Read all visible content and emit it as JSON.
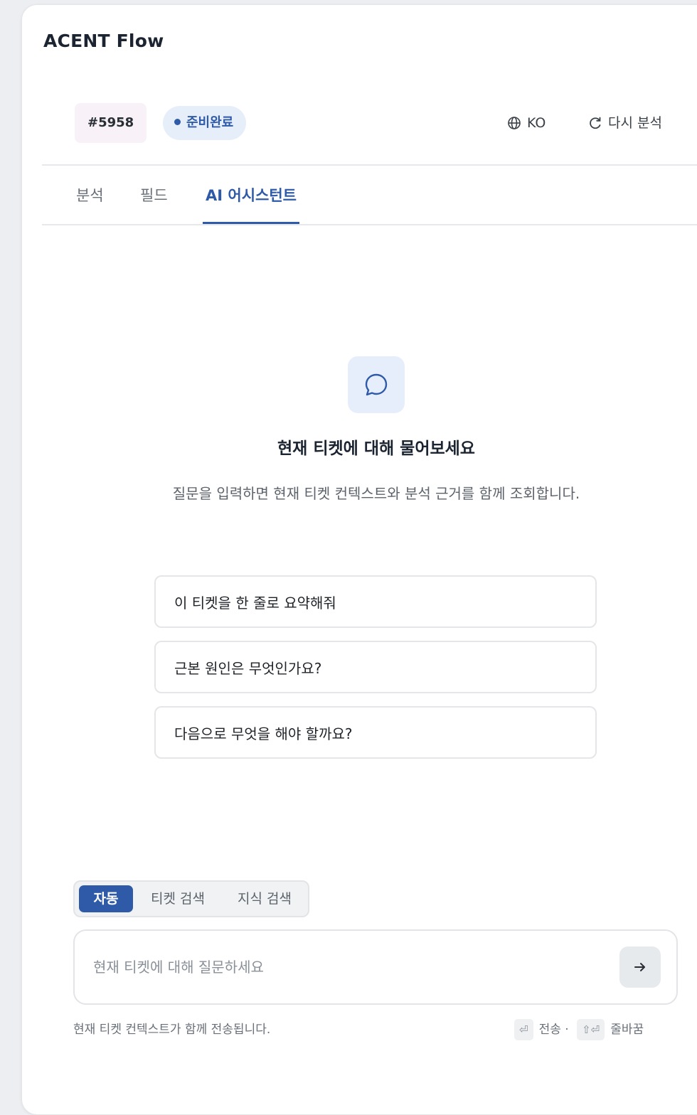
{
  "app": {
    "title": "ACENT Flow"
  },
  "ticket": {
    "id": "#5958",
    "status": "준비완료"
  },
  "header_actions": {
    "language": "KO",
    "reanalyze": "다시 분석"
  },
  "tabs": [
    {
      "label": "분석",
      "active": false
    },
    {
      "label": "필드",
      "active": false
    },
    {
      "label": "AI 어시스턴트",
      "active": true
    }
  ],
  "empty_state": {
    "icon": "chat-bubble-icon",
    "title": "현재 티켓에 대해 물어보세요",
    "description": "질문을 입력하면 현재 티켓 컨텍스트와 분석 근거를 함께 조회합니다."
  },
  "suggestions": [
    "이 티켓을 한 줄로 요약해줘",
    "근본 원인은 무엇인가요?",
    "다음으로 무엇을 해야 할까요?"
  ],
  "modes": [
    {
      "label": "자동",
      "active": true
    },
    {
      "label": "티켓 검색",
      "active": false
    },
    {
      "label": "지식 검색",
      "active": false
    }
  ],
  "composer": {
    "placeholder": "현재 티켓에 대해 질문하세요",
    "value": ""
  },
  "footer": {
    "note": "현재 티켓 컨텍스트가 함께 전송됩니다.",
    "send_key": "⏎",
    "send_label": "전송 ·",
    "newline_key": "⇧⏎",
    "newline_label": "줄바꿈"
  },
  "colors": {
    "accent": "#2f5aa8",
    "accent_soft": "#e6eefa",
    "ticket_badge_bg": "#f8f2f8"
  }
}
